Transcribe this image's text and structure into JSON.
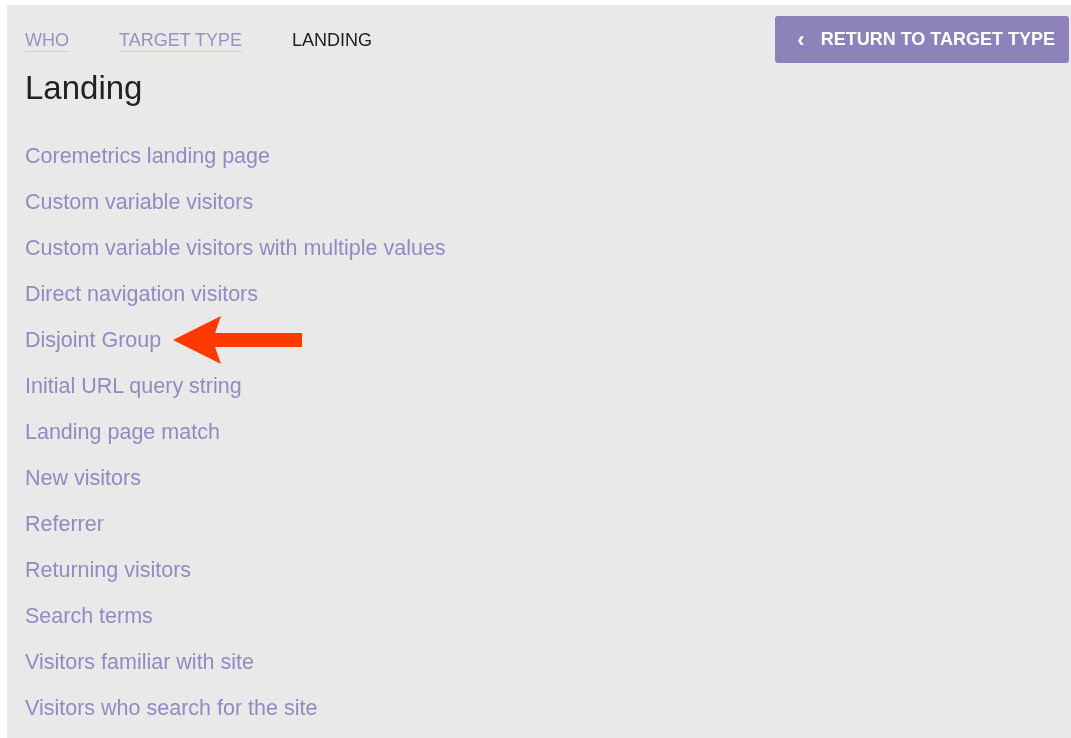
{
  "breadcrumbs": [
    {
      "label": "WHO",
      "link": true
    },
    {
      "label": "TARGET TYPE",
      "link": true
    },
    {
      "label": "LANDING",
      "link": false
    }
  ],
  "return_button": {
    "icon": "‹",
    "label": "RETURN TO TARGET TYPE"
  },
  "title": "Landing",
  "items": [
    {
      "label": "Coremetrics landing page",
      "pointed": false
    },
    {
      "label": "Custom variable visitors",
      "pointed": false
    },
    {
      "label": "Custom variable visitors with multiple values",
      "pointed": false
    },
    {
      "label": "Direct navigation visitors",
      "pointed": false
    },
    {
      "label": "Disjoint Group",
      "pointed": true
    },
    {
      "label": "Initial URL query string",
      "pointed": false
    },
    {
      "label": "Landing page match",
      "pointed": false
    },
    {
      "label": "New visitors",
      "pointed": false
    },
    {
      "label": "Referrer",
      "pointed": false
    },
    {
      "label": "Returning visitors",
      "pointed": false
    },
    {
      "label": "Search terms",
      "pointed": false
    },
    {
      "label": "Visitors familiar with site",
      "pointed": false
    },
    {
      "label": "Visitors who search for the site",
      "pointed": false
    }
  ]
}
